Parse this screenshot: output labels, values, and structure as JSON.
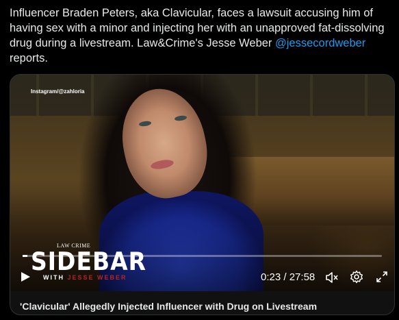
{
  "post": {
    "text_before": "Influencer Braden Peters, aka Clavicular, faces a lawsuit accusing him of having sex with a minor and injecting her with an unapproved fat-dissolving drug during a livestream. Law&Crime's Jesse Weber ",
    "mention": "@jessecordweber",
    "text_after": " reports."
  },
  "video": {
    "credit": "Instagram/@zahloria",
    "logo_top": "LAW CRIME",
    "logo_main": "SIDEBAR",
    "logo_with": "WITH",
    "logo_name": "JESSE WEBER",
    "progress": 0.014,
    "current_time": "0:23",
    "separator": "/",
    "duration": "27:58",
    "icons": [
      "play-icon",
      "mute-icon",
      "settings-icon",
      "fullscreen-icon"
    ],
    "caption": "'Clavicular' Allegedly Injected Influencer with Drug on Livestream"
  },
  "colors": {
    "background": "#000000",
    "text": "#e7e9ea",
    "link": "#1d9bf0",
    "logo_accent": "#b52424"
  }
}
